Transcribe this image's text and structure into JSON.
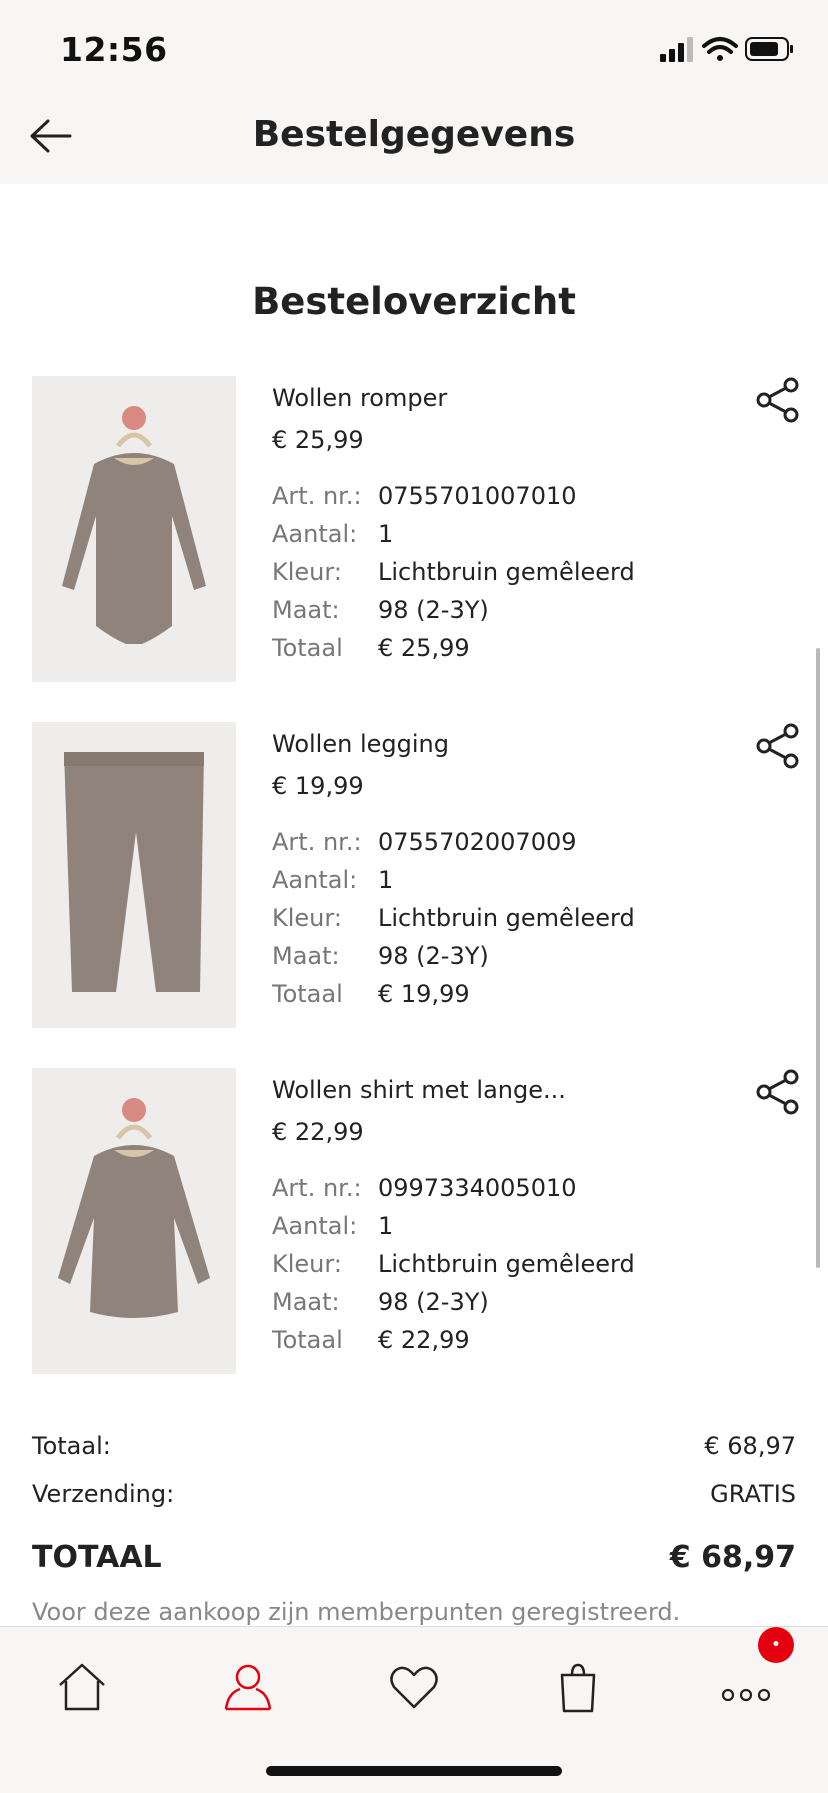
{
  "status_bar": {
    "time": "12:56",
    "icons": [
      "signal-icon",
      "wifi-icon",
      "battery-icon"
    ]
  },
  "header": {
    "title": "Bestelgegevens",
    "back_icon": "arrow-left-icon"
  },
  "order": {
    "section_title": "Besteloverzicht",
    "detail_labels": {
      "art_nr": "Art. nr.:",
      "aantal": "Aantal:",
      "kleur": "Kleur:",
      "maat": "Maat:",
      "totaal": "Totaal"
    },
    "items": [
      {
        "name": "Wollen romper",
        "price": "€ 25,99",
        "art_nr": "0755701007010",
        "aantal": "1",
        "kleur": "Lichtbruin gemêleerd",
        "maat": "98 (2-3Y)",
        "totaal": "€ 25,99",
        "image": "romper-image"
      },
      {
        "name": "Wollen legging",
        "price": "€ 19,99",
        "art_nr": "0755702007009",
        "aantal": "1",
        "kleur": "Lichtbruin gemêleerd",
        "maat": "98 (2-3Y)",
        "totaal": "€ 19,99",
        "image": "legging-image"
      },
      {
        "name": "Wollen shirt met lange...",
        "price": "€ 22,99",
        "art_nr": "0997334005010",
        "aantal": "1",
        "kleur": "Lichtbruin gemêleerd",
        "maat": "98 (2-3Y)",
        "totaal": "€ 22,99",
        "image": "shirt-image"
      }
    ]
  },
  "summary": {
    "subtotal_label": "Totaal:",
    "subtotal_value": "€ 68,97",
    "shipping_label": "Verzending:",
    "shipping_value": "GRATIS",
    "total_label": "TOTAAL",
    "total_value": "€ 68,97",
    "member_note": "Voor deze aankoop zijn memberpunten geregistreerd."
  },
  "tabbar": {
    "tabs": [
      "home-icon",
      "account-icon",
      "favorites-icon",
      "bag-icon",
      "more-icon"
    ],
    "active_tab": "account-icon",
    "badge_text": "•",
    "accent_color": "#e50010"
  },
  "colors": {
    "background": "#ffffff",
    "bar_background": "#f7f6f4",
    "text": "#222222",
    "muted_text": "#777777",
    "accent": "#e50010"
  }
}
